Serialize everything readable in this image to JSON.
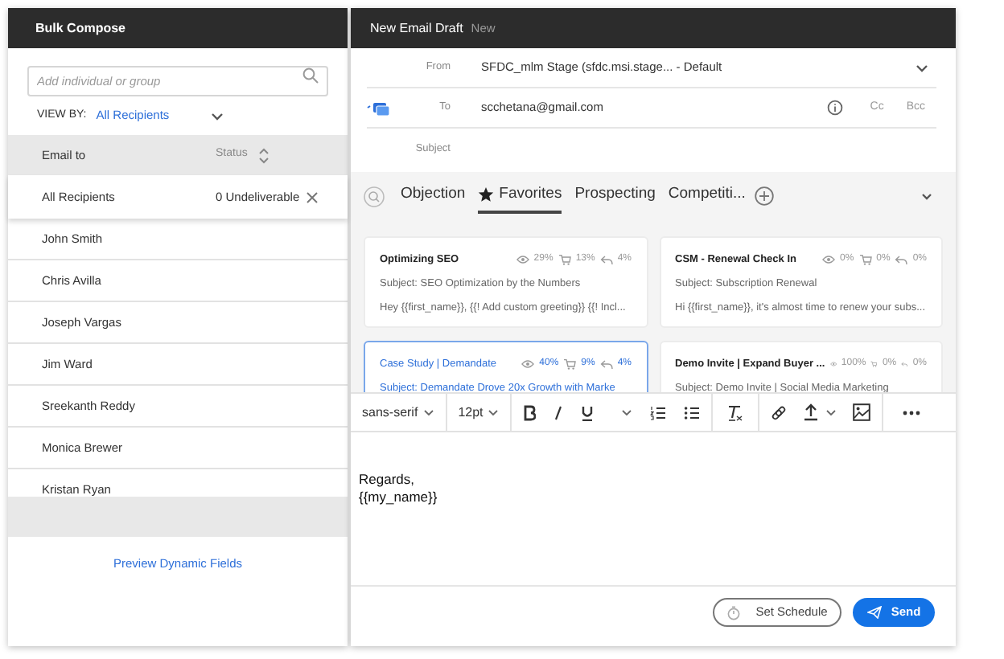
{
  "bulk": {
    "title": "Bulk Compose",
    "search": {
      "placeholder": "Add individual or group"
    },
    "view_by": {
      "label": "VIEW BY:",
      "value": "All Recipients"
    },
    "table": {
      "columns": [
        "Email to",
        "Status"
      ],
      "summary": {
        "name": "All Recipients",
        "status": "0 Undeliverable"
      },
      "rows": [
        "John Smith",
        "Chris Avilla",
        "Joseph Vargas",
        "Jim Ward",
        "Sreekanth Reddy",
        "Monica Brewer",
        "Kristan Ryan"
      ]
    },
    "link": "Preview Dynamic Fields"
  },
  "draft": {
    "title": "New Email Draft",
    "badge": "New",
    "fields": [
      {
        "kind": "dropdown",
        "label": "From",
        "value": "SFDC_mlm Stage (sfdc.msi.stage... - Default"
      },
      {
        "kind": "recipients",
        "label": "To",
        "value": "scchetana@gmail.com",
        "actions": [
          "Cc",
          "Bcc"
        ]
      },
      {
        "kind": "text",
        "label": "Subject"
      }
    ],
    "tabs": [
      {
        "label": "Objection",
        "selected": false,
        "starred": false
      },
      {
        "label": "Favorites",
        "selected": true,
        "starred": true
      },
      {
        "label": "Prospecting",
        "selected": false,
        "starred": false
      },
      {
        "label": "Competiti...",
        "selected": false,
        "starred": false
      }
    ],
    "templates": [
      {
        "name": "Optimizing SEO",
        "opens": "29%",
        "clicks": "13%",
        "replies": "4%",
        "subject": "Subject: SEO Optimization by the Numbers",
        "preview": "Hey {{first_name}}, {{! Add custom greeting}} {{! Incl...",
        "selected": false
      },
      {
        "name": "CSM - Renewal Check In",
        "opens": "0%",
        "clicks": "0%",
        "replies": "0%",
        "subject": "Subject: Subscription Renewal",
        "preview": "Hi {{first_name}}, it's almost time to renew your subs...",
        "selected": false
      },
      {
        "name": "Case Study | Demandate",
        "opens": "40%",
        "clicks": "9%",
        "replies": "4%",
        "subject": "Subject: Demandate Drove 20x Growth with Marke",
        "selected": true
      },
      {
        "name": "Demo Invite | Expand Buyer ...",
        "opens": "100%",
        "clicks": "0%",
        "replies": "0%",
        "subject": "Subject: Demo Invite | Social Media Marketing",
        "selected": false
      }
    ],
    "toolbar": {
      "font": "sans-serif",
      "size": "12pt"
    },
    "body": [
      "Regards,",
      "{{my_name}}"
    ],
    "buttons": [
      {
        "kind": "secondary",
        "label": "Set Schedule"
      },
      {
        "kind": "primary",
        "label": "Send"
      }
    ]
  }
}
